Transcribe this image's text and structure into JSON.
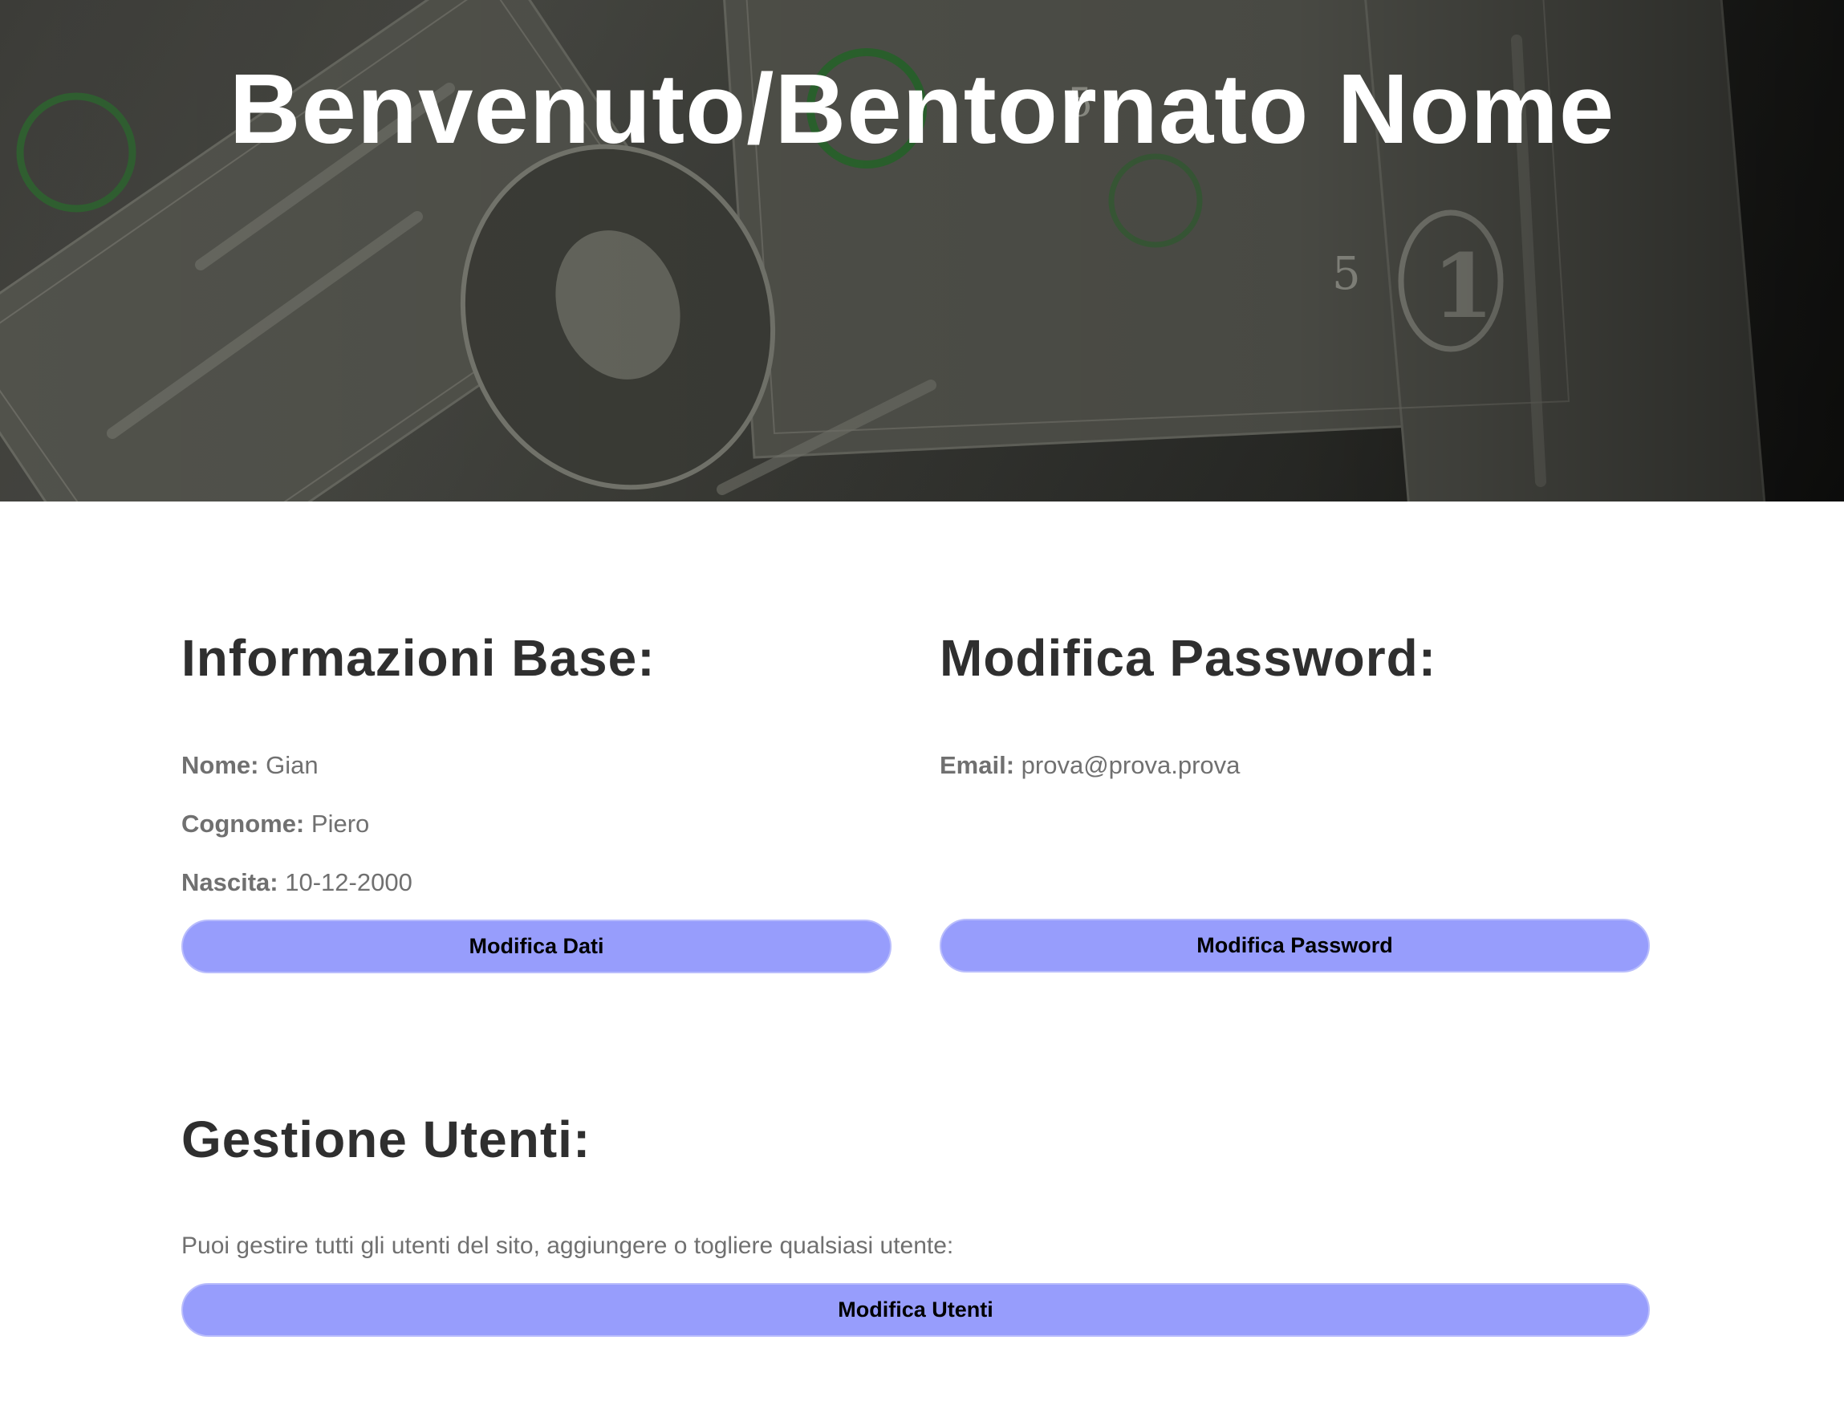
{
  "hero": {
    "title": "Benvenuto/Bentornato Nome",
    "background_image": "dollar-bills-photo"
  },
  "basic_info": {
    "title": "Informazioni Base:",
    "fields": [
      {
        "label": "Nome:",
        "value": "Gian"
      },
      {
        "label": "Cognome:",
        "value": "Piero"
      },
      {
        "label": "Nascita:",
        "value": "10-12-2000"
      }
    ],
    "button_label": "Modifica Dati"
  },
  "password": {
    "title": "Modifica Password:",
    "email_label": "Email:",
    "email_value": "prova@prova.prova",
    "button_label": "Modifica Password"
  },
  "users": {
    "title": "Gestione Utenti:",
    "description": "Puoi gestire tutti gli utenti del sito, aggiungere o togliere qualsiasi utente:",
    "button_label": "Modifica Utenti"
  },
  "colors": {
    "button_bg": "#979dfc",
    "heading": "#2f2f2f",
    "text": "#707070"
  }
}
